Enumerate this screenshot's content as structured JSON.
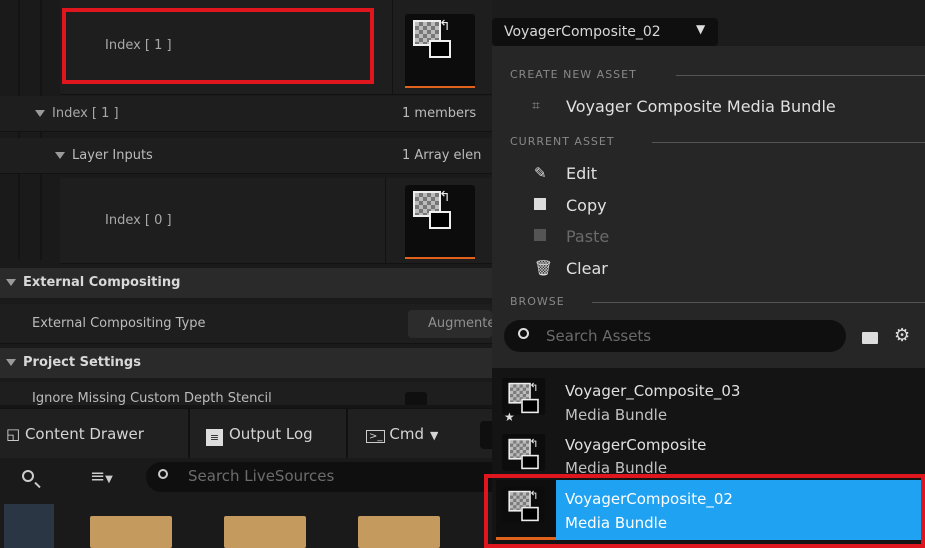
{
  "details": {
    "row1_label": "Index [ 1 ]",
    "row2_label": "Index [ 1 ]",
    "row2_value": "1 members",
    "row3_label": "Layer Inputs",
    "row3_value": "1 Array elen",
    "row4_label": "Index [ 0 ]",
    "section_external": "External Compositing",
    "external_type_label": "External Compositing Type",
    "external_type_value": "Augmente",
    "section_project": "Project Settings",
    "partial_row": "Ignore Missing Custom Depth Stencil"
  },
  "combo": {
    "selected": "VoyagerComposite_02"
  },
  "menu": {
    "create_header": "CREATE NEW ASSET",
    "create_item": "Voyager Composite Media Bundle",
    "current_header": "CURRENT ASSET",
    "edit": "Edit",
    "copy": "Copy",
    "paste": "Paste",
    "clear": "Clear",
    "browse_header": "BROWSE",
    "search_placeholder": "Search Assets"
  },
  "assets": [
    {
      "name": "Voyager_Composite_03",
      "type": "Media Bundle"
    },
    {
      "name": "VoyagerComposite",
      "type": "Media Bundle"
    },
    {
      "name": "VoyagerComposite_02",
      "type": "Media Bundle"
    }
  ],
  "bottom": {
    "content_drawer": "Content Drawer",
    "output_log": "Output Log",
    "cmd": "Cmd",
    "search_placeholder": "Search LiveSources"
  },
  "colors": {
    "highlight_red": "#e0161e",
    "selected_blue": "#1fa2f2",
    "accent_orange": "#e0621d"
  }
}
